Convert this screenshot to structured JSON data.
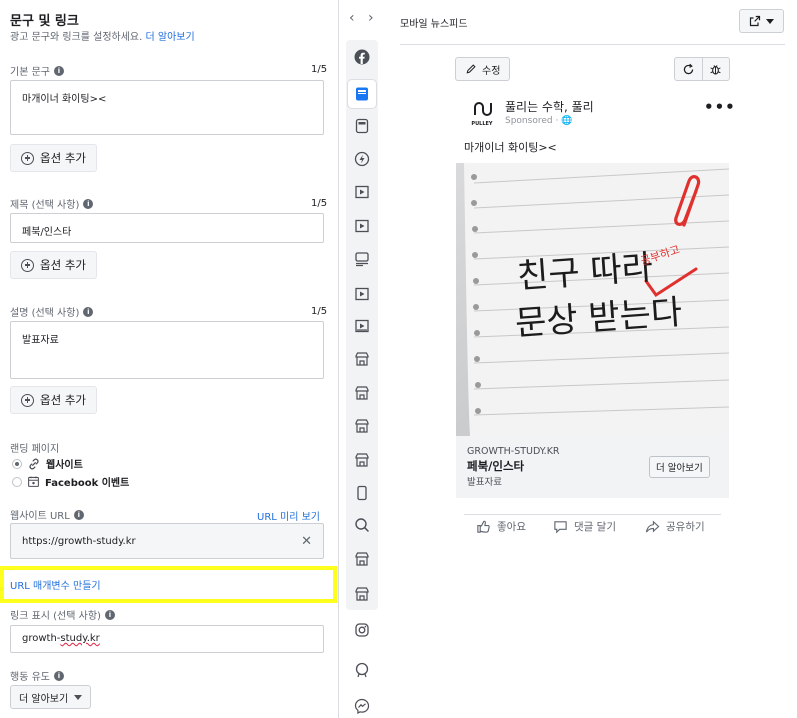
{
  "editor": {
    "section_title": "문구 및 링크",
    "section_subtitle": "광고 문구와 링크를 설정하세요.",
    "learn_more_link": "더 알아보기",
    "primary_text": {
      "label": "기본 문구",
      "count": "1/5",
      "value": "마개이너 화이팅><"
    },
    "headline": {
      "label": "제목 (선택 사항)",
      "count": "1/5",
      "value": "페북/인스타"
    },
    "description": {
      "label": "설명 (선택 사항)",
      "count": "1/5",
      "value": "발표자료"
    },
    "add_option_label": "옵션 추가",
    "landing": {
      "label": "랜딩 페이지",
      "option_website": "웹사이트",
      "option_event": "Facebook 이벤트",
      "selected": "웹사이트"
    },
    "website_url": {
      "label": "웹사이트 URL",
      "preview_link": "URL 미리 보기",
      "value": "https://growth-study.kr"
    },
    "url_params_link": "URL 매개변수 만들기",
    "display_link": {
      "label": "링크 표시 (선택 사항)",
      "value_prefix": "growth-",
      "value_squiggle": "study.kr"
    },
    "cta": {
      "label": "행동 유도",
      "selected": "더 알아보기"
    }
  },
  "placements": {
    "icons": [
      "facebook-icon",
      "feed-icon",
      "stories-icon",
      "instant-articles-icon",
      "video-icon",
      "in-stream-video-icon",
      "marketplace-icon",
      "video-feed-icon",
      "search-results-icon",
      "messenger-inbox-icon",
      "messenger-stories-icon",
      "audience-network-icon",
      "audience-network-2-icon",
      "phone-icon",
      "search-icon",
      "store-icon",
      "store-2-icon",
      "instagram-icon",
      "instagram-explore-icon",
      "messenger-icon"
    ],
    "selected": "feed-icon"
  },
  "preview": {
    "title": "모바일 뉴스피드",
    "edit_label": "수정",
    "page_name": "풀리는 수학, 풀리",
    "logo_text": "PULLEY",
    "sponsored": "Sponsored · ",
    "post_text": "마개이너 화이팅><",
    "creative": {
      "line1": "친구 따라",
      "line2": "문상 받는다",
      "stamp": "공부하고"
    },
    "link_box": {
      "domain": "GROWTH-STUDY.KR",
      "title": "페북/인스타",
      "description": "발표자료",
      "button": "더 알아보기"
    },
    "actions": {
      "like": "좋아요",
      "comment": "댓글 달기",
      "share": "공유하기"
    }
  },
  "colors": {
    "accent": "#216fdb",
    "highlight": "#ffff1e",
    "stamp_red": "#e0312f"
  }
}
